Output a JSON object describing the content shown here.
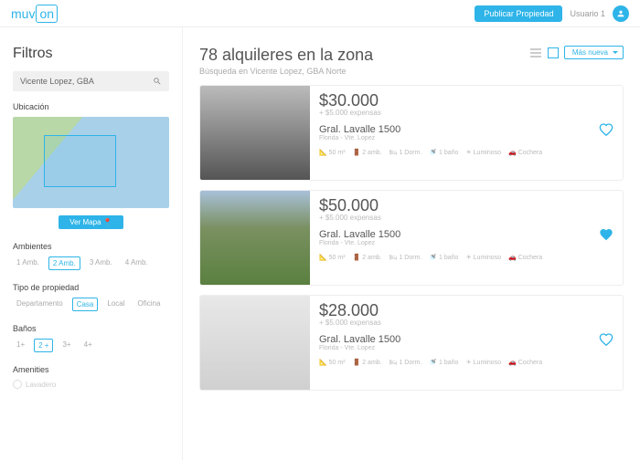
{
  "header": {
    "logo_muv": "muv",
    "logo_on": "on",
    "publish": "Publicar Propiedad",
    "user": "Usuario 1"
  },
  "filters": {
    "title": "Filtros",
    "search_value": "Vicente Lopez, GBA",
    "location_label": "Ubicación",
    "view_map": "Ver Mapa  📍",
    "ambientes_label": "Ambientes",
    "ambientes": [
      "1 Amb.",
      "2 Amb.",
      "3 Amb.",
      "4 Amb."
    ],
    "ambientes_active": 1,
    "tipo_label": "Tipo de propiedad",
    "tipos": [
      "Departamento",
      "Casa",
      "Local",
      "Oficina"
    ],
    "tipos_active": 1,
    "banos_label": "Baños",
    "banos": [
      "1+",
      "2 +",
      "3+",
      "4+"
    ],
    "banos_active": 1,
    "amenities_label": "Amenities",
    "amenity_1": "Lavadero"
  },
  "results": {
    "title": "78 alquileres en la zona",
    "subtitle": "Búsqueda en Vicente Lopez, GBA Norte",
    "sort": "Más nueva"
  },
  "listings": [
    {
      "price": "$30.000",
      "expenses": "+ $5.000 expensas",
      "address": "Gral. Lavalle 1500",
      "location": "Florida - Vte. Lopez",
      "area": "50 m²",
      "amb": "2 amb.",
      "dorm": "1 Dorm.",
      "bano": "1 baño",
      "luz": "Luminoso",
      "coch": "Cochera",
      "fav": false
    },
    {
      "price": "$50.000",
      "expenses": "+ $5.000 expensas",
      "address": "Gral. Lavalle 1500",
      "location": "Florida - Vte. Lopez",
      "area": "50 m²",
      "amb": "2 amb.",
      "dorm": "1 Dorm.",
      "bano": "1 baño",
      "luz": "Luminoso",
      "coch": "Cochera",
      "fav": true
    },
    {
      "price": "$28.000",
      "expenses": "+ $5.000 expensas",
      "address": "Gral. Lavalle 1500",
      "location": "Florida - Vte. Lopez",
      "area": "50 m²",
      "amb": "2 amb.",
      "dorm": "1 Dorm.",
      "bano": "1 baño",
      "luz": "Luminoso",
      "coch": "Cochera",
      "fav": false
    }
  ]
}
